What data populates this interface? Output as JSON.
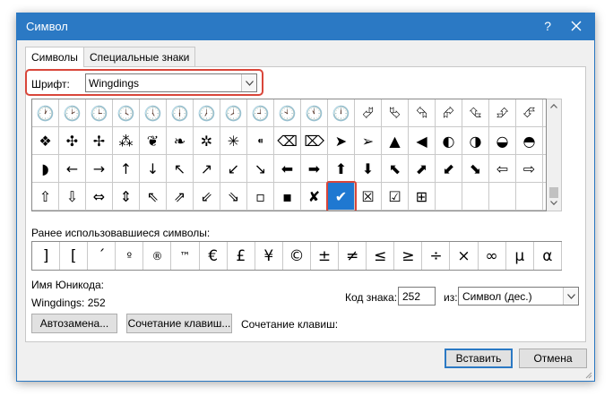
{
  "window": {
    "title": "Символ",
    "help": "?"
  },
  "tabs": [
    {
      "label": "Символы",
      "active": true
    },
    {
      "label": "Специальные знаки",
      "active": false
    }
  ],
  "font": {
    "label": "Шрифт:",
    "value": "Wingdings"
  },
  "grid": {
    "rows": [
      [
        "🕐",
        "🕑",
        "🕒",
        "🕓",
        "🕔",
        "🕕",
        "🕖",
        "🕗",
        "🕘",
        "🕙",
        "🕚",
        "🕛",
        "⮰",
        "⮱",
        "⮲",
        "⮳",
        "⮴",
        "⮵",
        "⮶",
        "⮷"
      ],
      [
        "❖",
        "✣",
        "✢",
        "⁂",
        "❦",
        "❧",
        "✲",
        "✳",
        "⁌",
        "⌫",
        "⌦",
        "➤",
        "➢",
        "▲",
        "◀",
        "◐",
        "◑",
        "◒",
        "◓",
        "◔"
      ],
      [
        "◗",
        "←",
        "→",
        "↑",
        "↓",
        "↖",
        "↗",
        "↙",
        "↘",
        "⬅",
        "➡",
        "⬆",
        "⬇",
        "⬉",
        "⬈",
        "⬋",
        "⬊",
        "⇦",
        "⇨",
        "⇧"
      ],
      [
        "⇧",
        "⇩",
        "⇔",
        "⇕",
        "⇖",
        "⇗",
        "⇙",
        "⇘",
        "▫",
        "▪",
        "✘",
        "✔",
        "☒",
        "☑",
        "⊞",
        "",
        "",
        "",
        "",
        ""
      ]
    ],
    "selected": {
      "row": 3,
      "col": 11
    }
  },
  "recent": {
    "label": "Ранее использовавшиеся символы:",
    "symbols": [
      "]",
      "[",
      "´",
      "º",
      "®",
      "™",
      "€",
      "£",
      "¥",
      "©",
      "±",
      "≠",
      "≤",
      "≥",
      "÷",
      "×",
      "∞",
      "µ",
      "α"
    ]
  },
  "unicode": {
    "name_label": "Имя Юникода:",
    "value": "Wingdings: 252"
  },
  "code": {
    "label": "Код знака:",
    "value": "252"
  },
  "from": {
    "label": "из:",
    "value": "Символ (дес.)"
  },
  "buttons": {
    "autocorrect": "Автозамена...",
    "shortcut_key": "Сочетание клавиш...",
    "shortcut_label": "Сочетание клавиш:",
    "insert": "Вставить",
    "cancel": "Отмена"
  },
  "colors": {
    "accent": "#2b79c4",
    "highlight": "#d9463a",
    "selected_cell": "#1f78d1"
  },
  "icons": {
    "close": "close-icon",
    "dropdown": "chevron-down-icon"
  }
}
